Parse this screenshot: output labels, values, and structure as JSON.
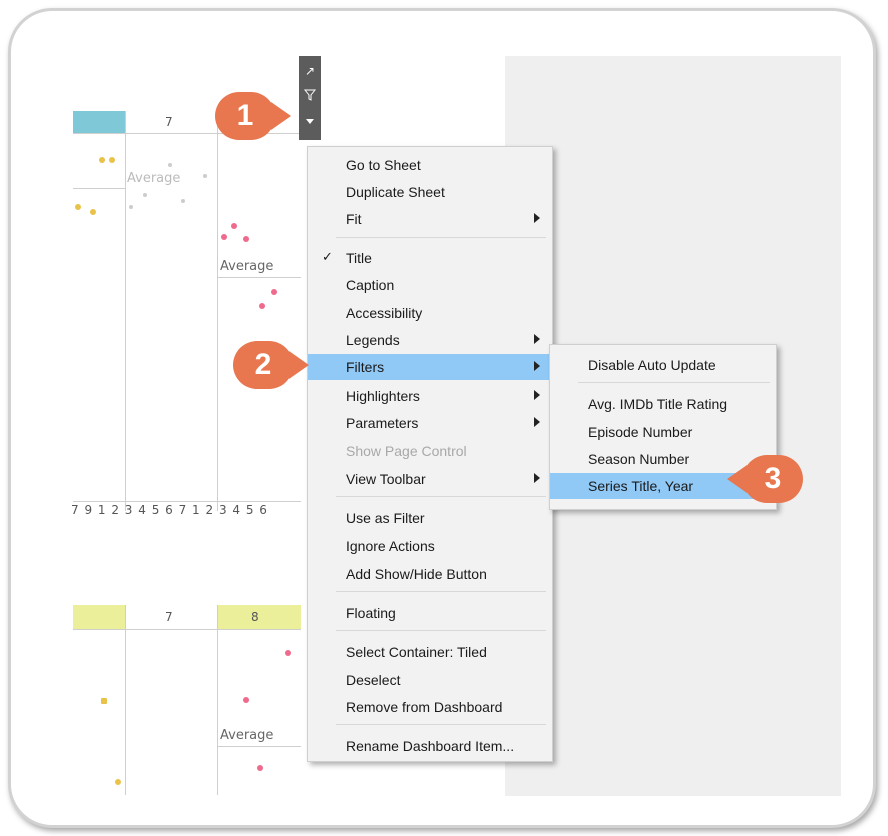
{
  "colors": {
    "menu_bg": "#f2f2f2",
    "highlight": "#90c8f6",
    "badge": "#e8764f",
    "header_blue": "#7ec8d8",
    "header_yellow": "#ecef9a",
    "dot_yellow": "#e9c24a",
    "dot_pink": "#ef6a8c"
  },
  "viz_top": {
    "header_7": "7",
    "average_1": "Average",
    "average_2": "Average",
    "axis_labels": "7   9   1 2 3 4 5 6 7 1 2 3 4 5 6"
  },
  "viz_bottom": {
    "header_7": "7",
    "header_8": "8",
    "average": "Average"
  },
  "toolbar": {
    "icons": [
      "pop-out-icon",
      "filter-icon",
      "dropdown-arrow-icon"
    ]
  },
  "badges": {
    "step1": "1",
    "step2": "2",
    "step3": "3"
  },
  "menu": {
    "items": [
      {
        "label": "Go to Sheet"
      },
      {
        "label": "Duplicate Sheet"
      },
      {
        "label": "Fit"
      },
      {
        "label": "Title",
        "checked": true
      },
      {
        "label": "Caption"
      },
      {
        "label": "Accessibility"
      },
      {
        "label": "Legends"
      },
      {
        "label": "Filters",
        "highlighted": true
      },
      {
        "label": "Highlighters"
      },
      {
        "label": "Parameters"
      },
      {
        "label": "Show Page Control",
        "disabled": true
      },
      {
        "label": "View Toolbar"
      },
      {
        "label": "Use as Filter"
      },
      {
        "label": "Ignore Actions"
      },
      {
        "label": "Add Show/Hide Button"
      },
      {
        "label": "Floating"
      },
      {
        "label": "Select Container: Tiled"
      },
      {
        "label": "Deselect"
      },
      {
        "label": "Remove from Dashboard"
      },
      {
        "label": "Rename Dashboard Item..."
      }
    ],
    "check_glyph": "✓"
  },
  "submenu": {
    "items": [
      {
        "label": "Disable Auto Update"
      },
      {
        "label": "Avg. IMDb Title Rating"
      },
      {
        "label": "Episode Number"
      },
      {
        "label": "Season Number"
      },
      {
        "label": "Series Title, Year",
        "highlighted": true
      }
    ]
  }
}
